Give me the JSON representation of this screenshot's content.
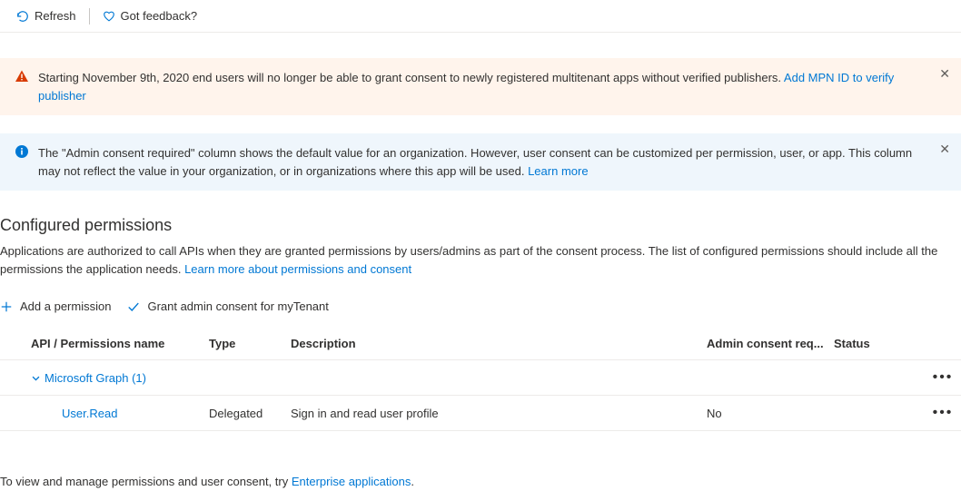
{
  "toolbar": {
    "refresh_label": "Refresh",
    "feedback_label": "Got feedback?"
  },
  "warning_banner": {
    "text": "Starting November 9th, 2020 end users will no longer be able to grant consent to newly registered multitenant apps without verified publishers. ",
    "link_text": "Add MPN ID to verify publisher"
  },
  "info_banner": {
    "text": "The \"Admin consent required\" column shows the default value for an organization. However, user consent can be customized per permission, user, or app. This column may not reflect the value in your organization, or in organizations where this app will be used. ",
    "link_text": "Learn more"
  },
  "section": {
    "heading": "Configured permissions",
    "description": "Applications are authorized to call APIs when they are granted permissions by users/admins as part of the consent process. The list of configured permissions should include all the permissions the application needs. ",
    "description_link": "Learn more about permissions and consent"
  },
  "actions": {
    "add_permission": "Add a permission",
    "grant_consent": "Grant admin consent for myTenant"
  },
  "table": {
    "headers": {
      "name": "API / Permissions name",
      "type": "Type",
      "description": "Description",
      "consent": "Admin consent req...",
      "status": "Status"
    },
    "group": {
      "label": "Microsoft Graph (1)"
    },
    "row": {
      "name": "User.Read",
      "type": "Delegated",
      "description": "Sign in and read user profile",
      "consent": "No",
      "status": ""
    }
  },
  "footer": {
    "text": "To view and manage permissions and user consent, try ",
    "link_text": "Enterprise applications",
    "suffix": "."
  }
}
